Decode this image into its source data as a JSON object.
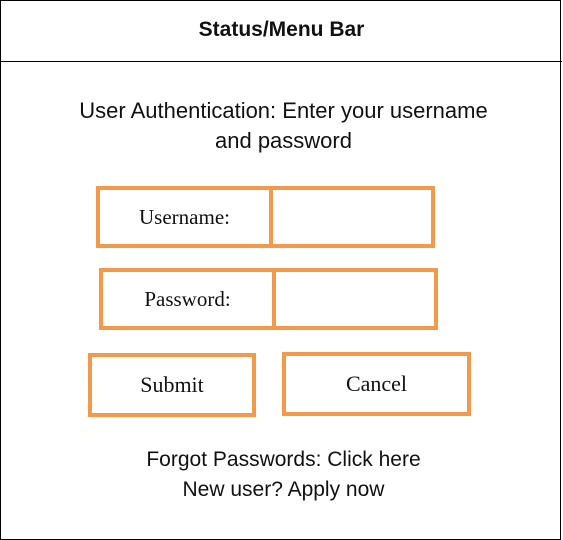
{
  "status_bar": {
    "title": "Status/Menu Bar"
  },
  "auth": {
    "heading_line1": "User Authentication: Enter your username",
    "heading_line2": "and password",
    "username_label": "Username:",
    "username_value": "",
    "password_label": "Password:",
    "password_value": "",
    "submit_label": "Submit",
    "cancel_label": "Cancel",
    "forgot_text": "Forgot Passwords: Click here",
    "new_user_text": "New user? Apply now"
  },
  "colors": {
    "accent_border": "#f29a4c",
    "frame_border": "#000000",
    "background": "#ffffff"
  }
}
